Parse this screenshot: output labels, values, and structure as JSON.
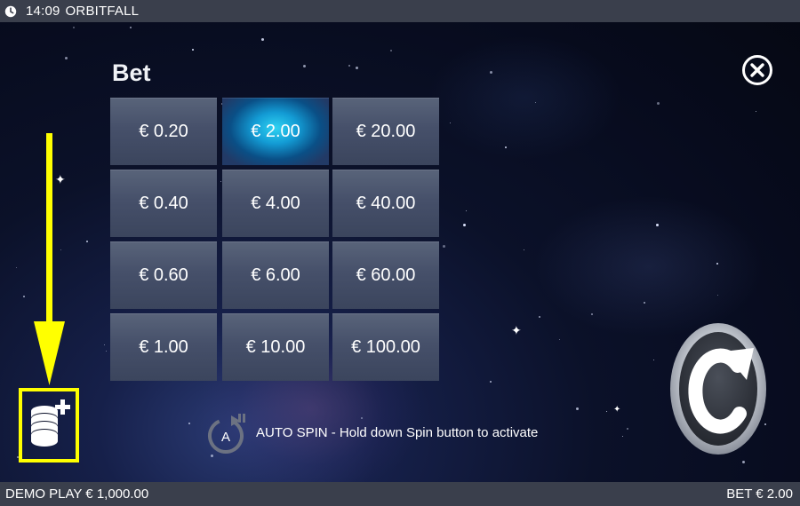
{
  "status_bar": {
    "time": "14:09",
    "app_title": "ORBITFALL",
    "clock_icon": "clock-icon"
  },
  "bet_panel": {
    "title": "Bet",
    "selected_value": "€ 2.00",
    "options": [
      [
        "€ 0.20",
        "€ 2.00",
        "€ 20.00"
      ],
      [
        "€ 0.40",
        "€ 4.00",
        "€ 40.00"
      ],
      [
        "€ 0.60",
        "€ 6.00",
        "€ 60.00"
      ],
      [
        "€ 1.00",
        "€ 10.00",
        "€ 100.00"
      ]
    ],
    "selected_color": "#17a9de"
  },
  "auto_spin": {
    "icon_letter": "A",
    "title": "AUTO SPIN",
    "hint": " - Hold down Spin button to activate"
  },
  "annotation": {
    "color": "#ffff00",
    "target": "bet-settings-coins-icon"
  },
  "footer": {
    "balance": "DEMO PLAY € 1,000.00",
    "bet": "BET € 2.00"
  }
}
